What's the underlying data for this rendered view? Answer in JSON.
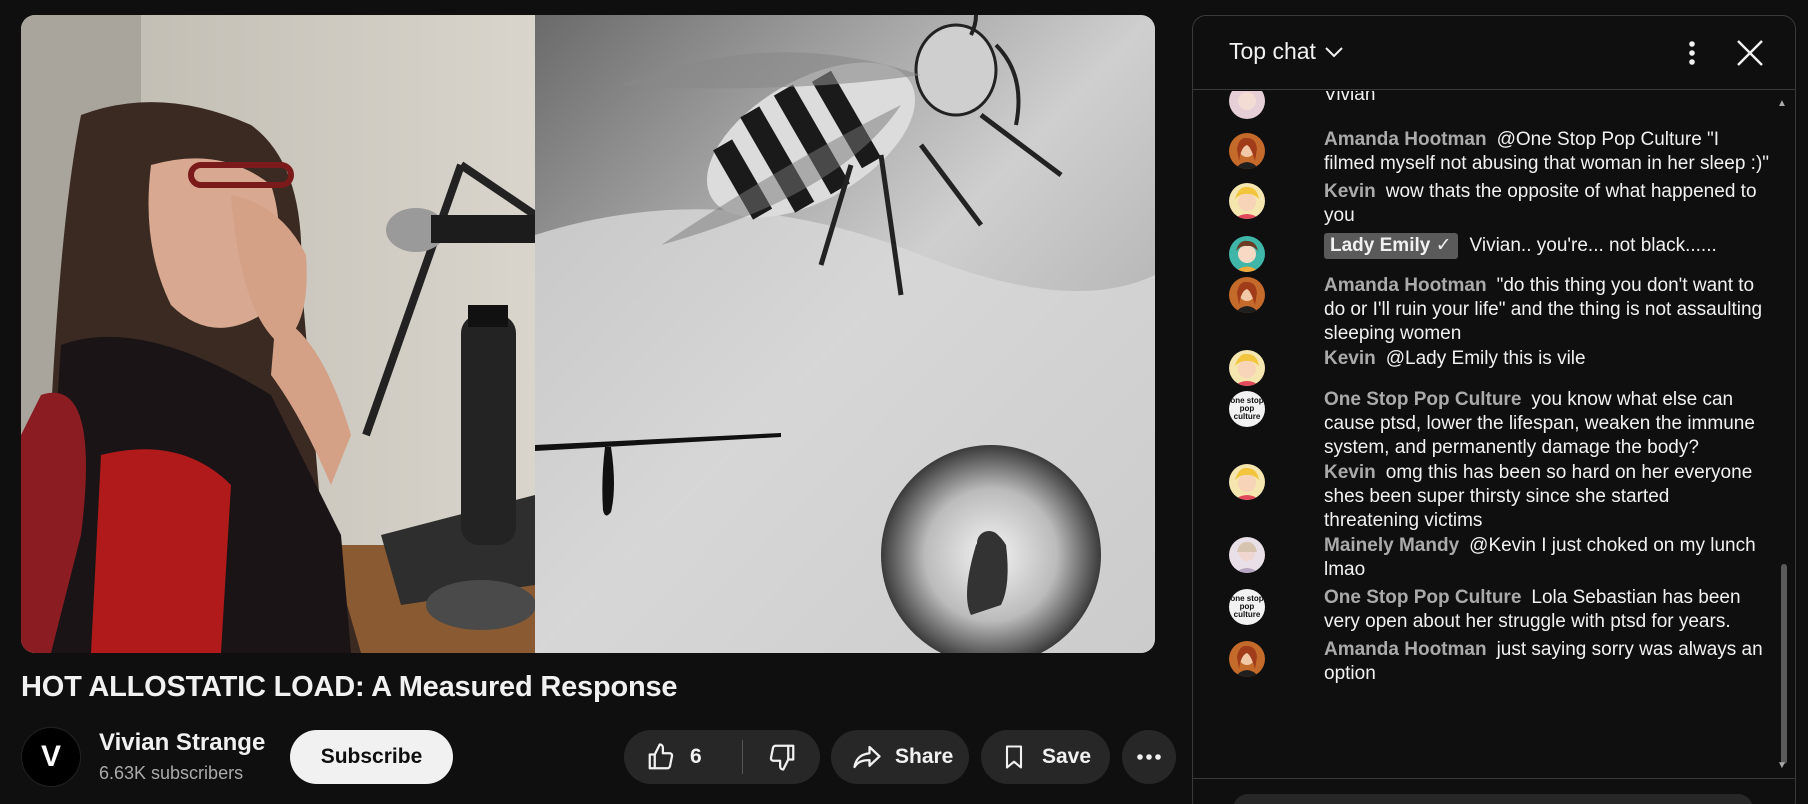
{
  "video": {
    "title": "HOT ALLOSTATIC LOAD: A Measured Response"
  },
  "channel": {
    "avatar_letter": "V",
    "name": "Vivian Strange",
    "subscribers": "6.63K subscribers",
    "subscribe_label": "Subscribe"
  },
  "actions": {
    "like_count": "6",
    "share_label": "Share",
    "save_label": "Save",
    "more_label": "···"
  },
  "chat": {
    "title": "Top chat",
    "messages": [
      {
        "author": "",
        "text": "Vivian",
        "avatar": "pink"
      },
      {
        "author": "Amanda Hootman",
        "text": "@One Stop Pop Culture \"I filmed myself not abusing that woman in her sleep :)\"",
        "avatar": "redhead"
      },
      {
        "author": "Kevin",
        "text": "wow thats the opposite of what happened to you",
        "avatar": "blonde"
      },
      {
        "author": "Lady Emily ✓",
        "text": "Vivian.. you're... not black......",
        "avatar": "teal",
        "badge": true
      },
      {
        "author": "Amanda Hootman",
        "text": "\"do this thing you don't want to do or I'll ruin your life\" and the thing is not assaulting sleeping women",
        "avatar": "redhead"
      },
      {
        "author": "Kevin",
        "text": "@Lady Emily this is vile",
        "avatar": "blonde"
      },
      {
        "author": "One Stop Pop Culture",
        "text": "you know what else can cause ptsd, lower the lifespan, weaken the immune system, and permanently damage the body?",
        "avatar": "logo"
      },
      {
        "author": "Kevin",
        "text": "omg this has been so hard on her everyone shes been super thirsty since she started threatening victims",
        "avatar": "blonde"
      },
      {
        "author": "Mainely Mandy",
        "text": "@Kevin I just choked on my lunch lmao",
        "avatar": "pale"
      },
      {
        "author": "One Stop Pop Culture",
        "text": "Lola Sebastian has been very open about her struggle with ptsd for years.",
        "avatar": "logo"
      },
      {
        "author": "Amanda Hootman",
        "text": "just saying sorry was always an option",
        "avatar": "redhead"
      }
    ],
    "logo_text": "one stop pop culture"
  },
  "colors": {
    "background": "#0f0f0f",
    "pill": "#272727",
    "muted": "#aaaaaa"
  }
}
